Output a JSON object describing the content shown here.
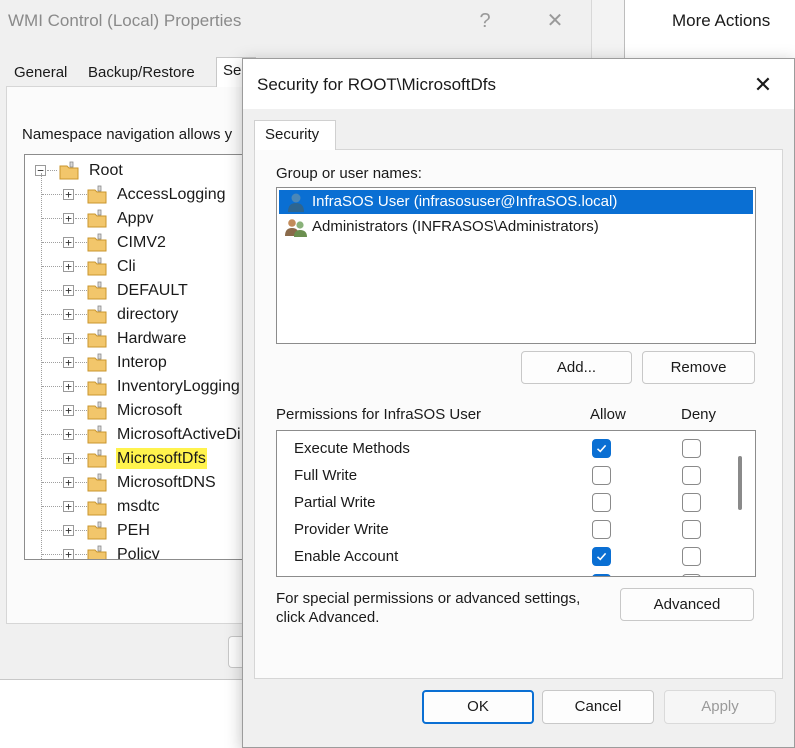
{
  "wmi_window": {
    "title": "WMI Control (Local) Properties",
    "help_glyph": "?",
    "close_glyph": "✕",
    "tabs": [
      "General",
      "Backup/Restore",
      "Se"
    ],
    "namespace_text": "Namespace navigation allows y",
    "tree": {
      "root": "Root",
      "expander_collapsed": "+",
      "expander_expanded": "−",
      "children": [
        "AccessLogging",
        "Appv",
        "CIMV2",
        "Cli",
        "DEFAULT",
        "directory",
        "Hardware",
        "Interop",
        "InventoryLogging",
        "Microsoft",
        "MicrosoftActiveDi",
        "MicrosoftDfs",
        "MicrosoftDNS",
        "msdtc",
        "PEH",
        "Policy"
      ],
      "selected": "MicrosoftDfs"
    }
  },
  "actions_pane": {
    "title": "More Actions"
  },
  "security_dialog": {
    "title": "Security for ROOT\\MicrosoftDfs",
    "close_glyph": "✕",
    "tab": "Security",
    "group_label": "Group or user names:",
    "users": [
      {
        "name": "InfraSOS User (infrasosuser@InfraSOS.local)",
        "selected": true,
        "icon": "user-icon"
      },
      {
        "name": "Administrators (INFRASOS\\Administrators)",
        "selected": false,
        "icon": "group-icon"
      }
    ],
    "add_button": "Add...",
    "remove_button": "Remove",
    "permissions_label": "Permissions for InfraSOS User",
    "allow_header": "Allow",
    "deny_header": "Deny",
    "permissions": [
      {
        "name": "Execute Methods",
        "allow": true,
        "deny": false
      },
      {
        "name": "Full Write",
        "allow": false,
        "deny": false
      },
      {
        "name": "Partial Write",
        "allow": false,
        "deny": false
      },
      {
        "name": "Provider Write",
        "allow": false,
        "deny": false
      },
      {
        "name": "Enable Account",
        "allow": true,
        "deny": false
      },
      {
        "name": "",
        "allow": true,
        "deny": false
      }
    ],
    "special_text": "For special permissions or advanced settings, click Advanced.",
    "advanced_button": "Advanced",
    "ok_button": "OK",
    "cancel_button": "Cancel",
    "apply_button": "Apply",
    "accent_color": "#0a6fd3",
    "highlight_color": "#fff34d"
  }
}
